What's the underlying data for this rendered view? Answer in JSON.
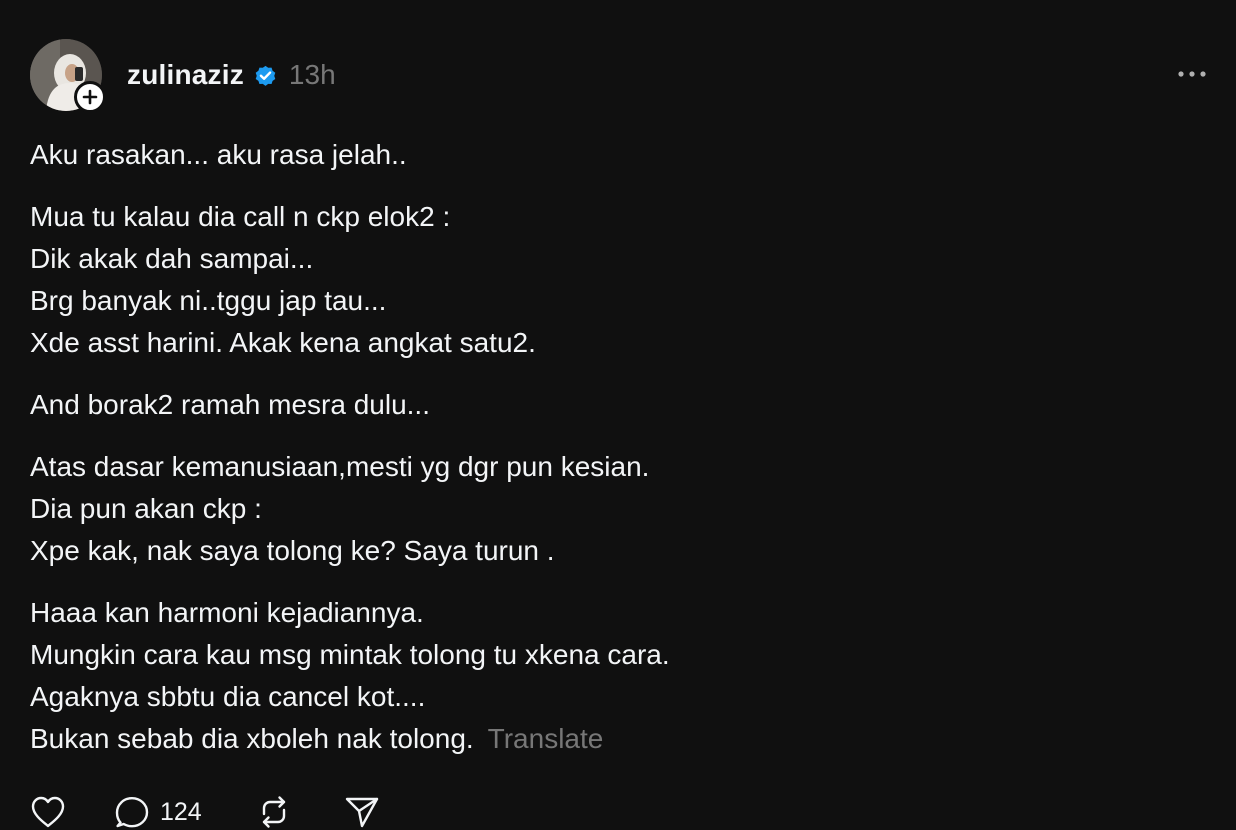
{
  "post": {
    "username": "zulinaziz",
    "time": "13h",
    "paragraphs": [
      {
        "lines": [
          "Aku rasakan... aku rasa jelah.."
        ]
      },
      {
        "lines": [
          "Mua tu kalau dia call n ckp elok2 :",
          "Dik akak dah sampai...",
          "Brg banyak ni..tggu jap tau...",
          "Xde asst harini. Akak kena angkat satu2."
        ]
      },
      {
        "lines": [
          "And borak2 ramah mesra dulu..."
        ]
      },
      {
        "lines": [
          "Atas dasar kemanusiaan,mesti yg dgr pun kesian.",
          "Dia pun akan ckp :",
          "Xpe kak, nak saya tolong ke? Saya turun ."
        ]
      },
      {
        "lines": [
          "Haaa kan harmoni kejadiannya.",
          "Mungkin cara kau msg mintak tolong tu xkena cara.",
          "Agaknya sbbtu dia cancel kot....",
          "Bukan sebab dia xboleh nak tolong."
        ]
      }
    ],
    "translate_label": "Translate",
    "actions": {
      "like_icon": "heart-icon",
      "reply_icon": "comment-icon",
      "reply_count": "124",
      "repost_icon": "repost-icon",
      "share_icon": "send-icon"
    }
  },
  "colors": {
    "background": "#101010",
    "text": "#f3f5f7",
    "muted": "#777777",
    "verified": "#1d9bf0"
  }
}
